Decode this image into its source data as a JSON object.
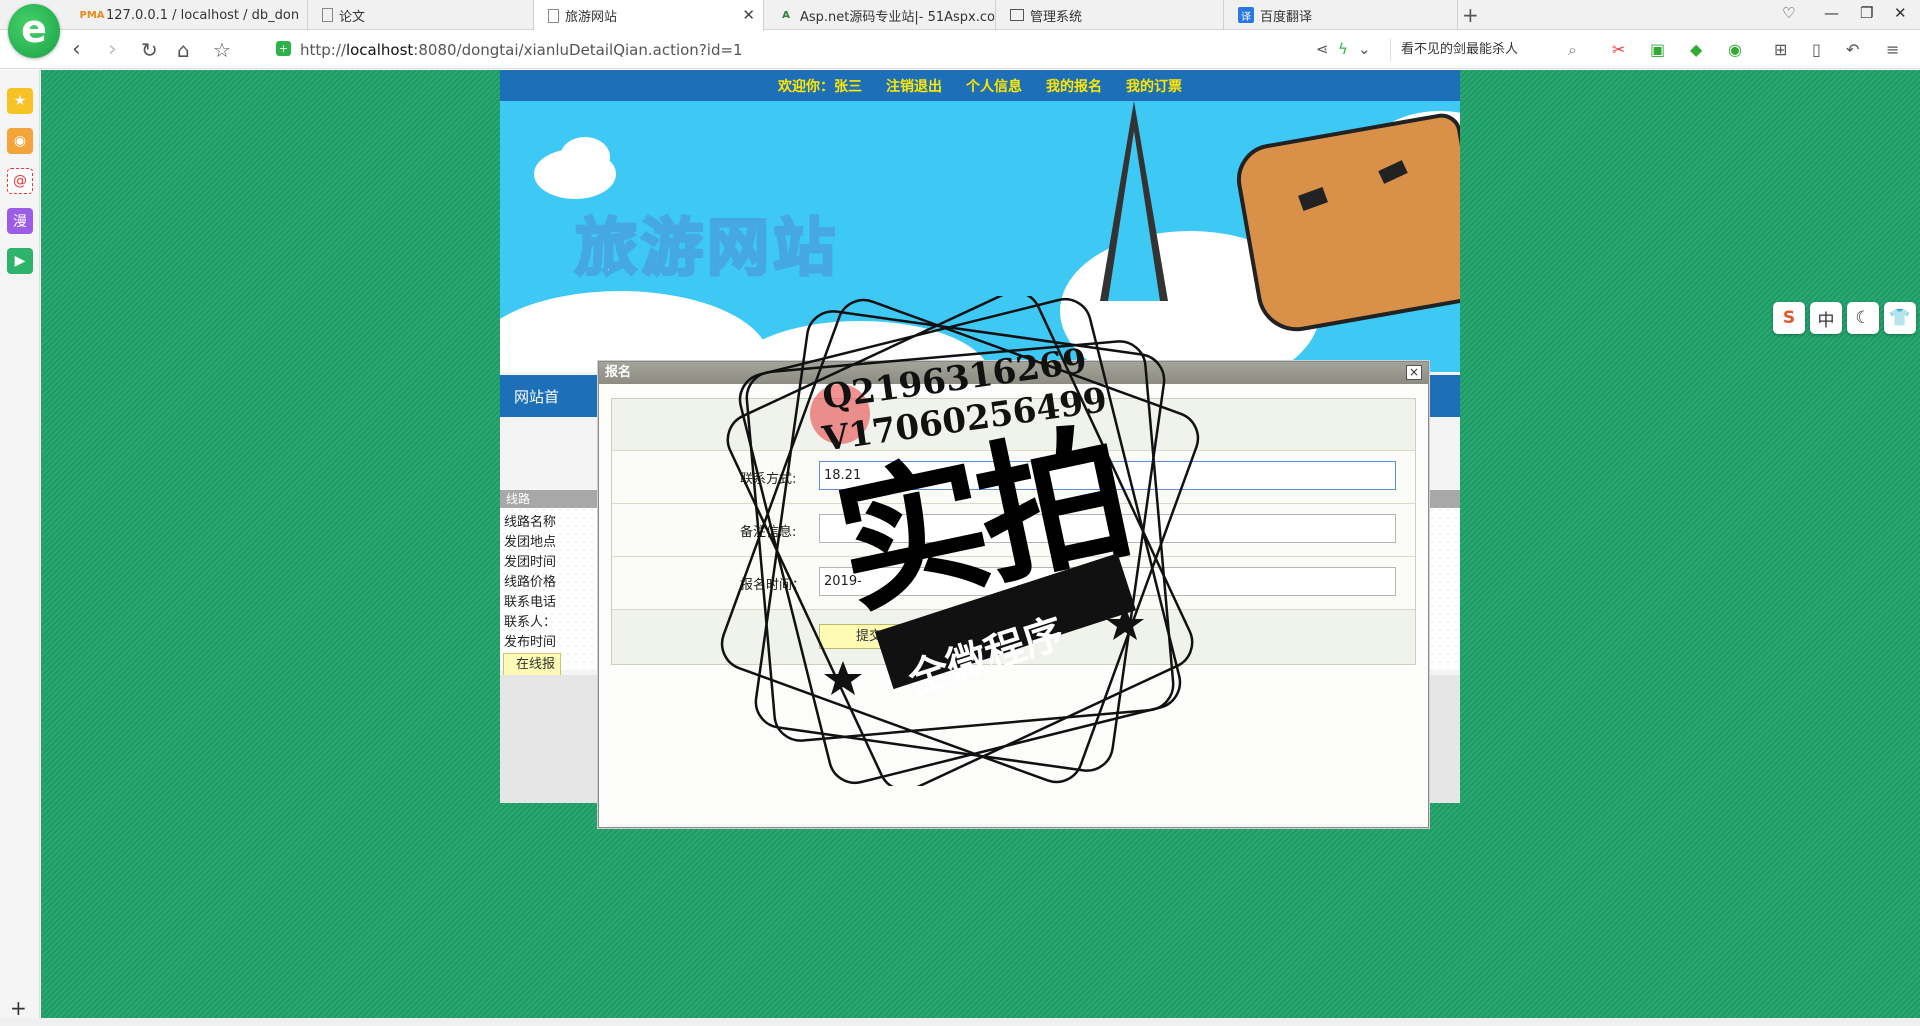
{
  "browser": {
    "tabs": [
      {
        "label": "127.0.0.1 / localhost / db_don",
        "icon": "phpmyadmin-icon"
      },
      {
        "label": "论文",
        "icon": "document-icon"
      },
      {
        "label": "旅游网站",
        "icon": "document-icon",
        "active": true
      },
      {
        "label": "Asp.net源码专业站|- 51Aspx.co",
        "icon": "aspx-icon"
      },
      {
        "label": "管理系统",
        "icon": "admin-icon"
      },
      {
        "label": "百度翻译",
        "icon": "baidu-translate-icon"
      }
    ],
    "url_prefix": "http://",
    "url_host": "localhost",
    "url_rest": ":8080/dongtai/xianluDetailQian.action?id=1",
    "search_text": "看不见的剑最能杀人",
    "logo_letter": "e"
  },
  "site": {
    "nav": {
      "welcome": "欢迎你：张三",
      "logout": "注销退出",
      "profile": "个人信息",
      "my_signup": "我的报名",
      "my_orders": "我的订票"
    },
    "banner_title": "旅游网站",
    "menu_label": "网站首",
    "line_header": "线路",
    "line_rows": [
      "线路名称",
      "发团地点",
      "发团时间",
      "线路价格",
      "联系电话",
      "联系人：",
      "发布时间"
    ],
    "apply_button": "在线报"
  },
  "modal": {
    "title": "报名",
    "close": "×",
    "fields": {
      "contact_label": "联系方式:",
      "contact_value": "18.21",
      "note_label": "备注信息:",
      "note_value": "",
      "time_label": "报名时间：",
      "time_value": "2019-"
    },
    "submit": "提交"
  },
  "watermark": {
    "qq": "Q2196316269",
    "wechat": "V17060256499",
    "main": "实拍",
    "sub": "全微程序"
  },
  "floating_toolbar": [
    "S",
    "中",
    "☾",
    "👕"
  ],
  "colors": {
    "page_bg": "#1f9a63",
    "nav_bg": "#1d6fb8",
    "nav_text": "#ffe600",
    "banner_bg": "#3ec8f4",
    "button_bg": "#fdfbb4"
  }
}
